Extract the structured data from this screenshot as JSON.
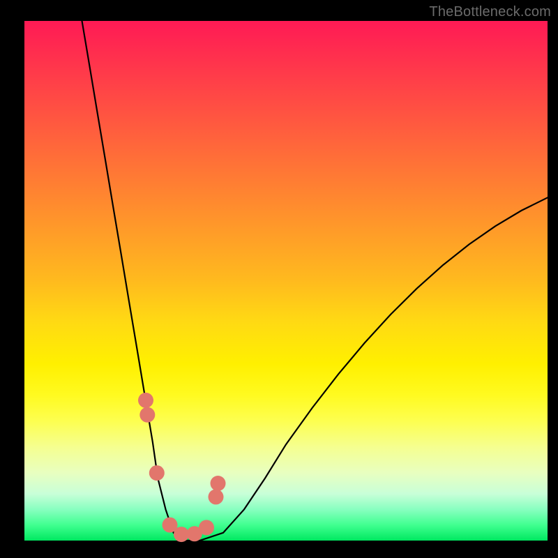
{
  "watermark": "TheBottleneck.com",
  "chart_data": {
    "type": "line",
    "title": "",
    "xlabel": "",
    "ylabel": "",
    "xlim": [
      0,
      100
    ],
    "ylim": [
      0,
      100
    ],
    "series": [
      {
        "name": "bottleneck-curve",
        "x": [
          11,
          12.5,
          14,
          15.5,
          17,
          18.5,
          20,
          21.5,
          23,
          24.5,
          25.5,
          27,
          28.5,
          30,
          33.5,
          38,
          42,
          46,
          50,
          55,
          60,
          65,
          70,
          75,
          80,
          85,
          90,
          95,
          100
        ],
        "values": [
          100,
          91,
          82,
          73,
          64,
          55,
          46,
          37,
          28,
          19,
          12,
          6,
          1.5,
          0,
          0,
          1.5,
          6,
          12,
          18.5,
          25.5,
          32,
          38,
          43.5,
          48.5,
          53,
          57,
          60.5,
          63.5,
          66
        ]
      }
    ],
    "markers": {
      "name": "highlight-points",
      "color": "#e2766c",
      "x": [
        23.2,
        23.5,
        25.3,
        27.8,
        30.0,
        32.5,
        34.8,
        36.6,
        37.0
      ],
      "values": [
        27.0,
        24.2,
        13.0,
        3.0,
        1.2,
        1.3,
        2.5,
        8.4,
        11.0
      ]
    },
    "gradient_stops": [
      {
        "pos": 0,
        "color": "#ff1a55"
      },
      {
        "pos": 50,
        "color": "#ffda13"
      },
      {
        "pos": 77,
        "color": "#fdff50"
      },
      {
        "pos": 100,
        "color": "#00e860"
      }
    ]
  }
}
